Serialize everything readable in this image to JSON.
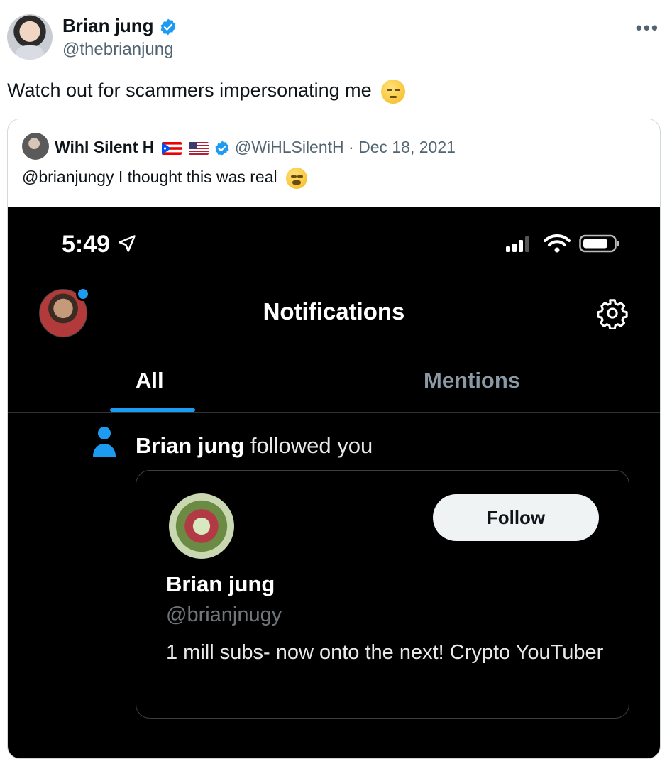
{
  "tweet": {
    "author_name": "Brian jung",
    "author_handle": "@thebrianjung",
    "more_label": "•••",
    "text": "Watch out for scammers impersonating me",
    "emoji": "pensive-face"
  },
  "quoted": {
    "author_name": "Wihl Silent H",
    "flags": [
      "puerto-rico-flag",
      "us-flag"
    ],
    "author_handle": "@WiHLSilentH",
    "separator": " · ",
    "date": "Dec 18, 2021",
    "text": "@brianjungy I thought this was real",
    "emoji": "tired-face"
  },
  "screenshot": {
    "time": "5:49",
    "title": "Notifications",
    "tabs": [
      {
        "label": "All",
        "active": true
      },
      {
        "label": "Mentions",
        "active": false
      }
    ],
    "notification": {
      "actor": "Brian jung",
      "action": " followed you"
    },
    "card": {
      "follow_label": "Follow",
      "name": "Brian jung",
      "handle": "@brianjnugy",
      "bio": "1 mill subs- now onto the next! Crypto YouTuber"
    }
  },
  "colors": {
    "accent": "#1d9bf0",
    "text_primary": "#0f1419",
    "text_secondary": "#536471",
    "dark_bg": "#000000"
  }
}
